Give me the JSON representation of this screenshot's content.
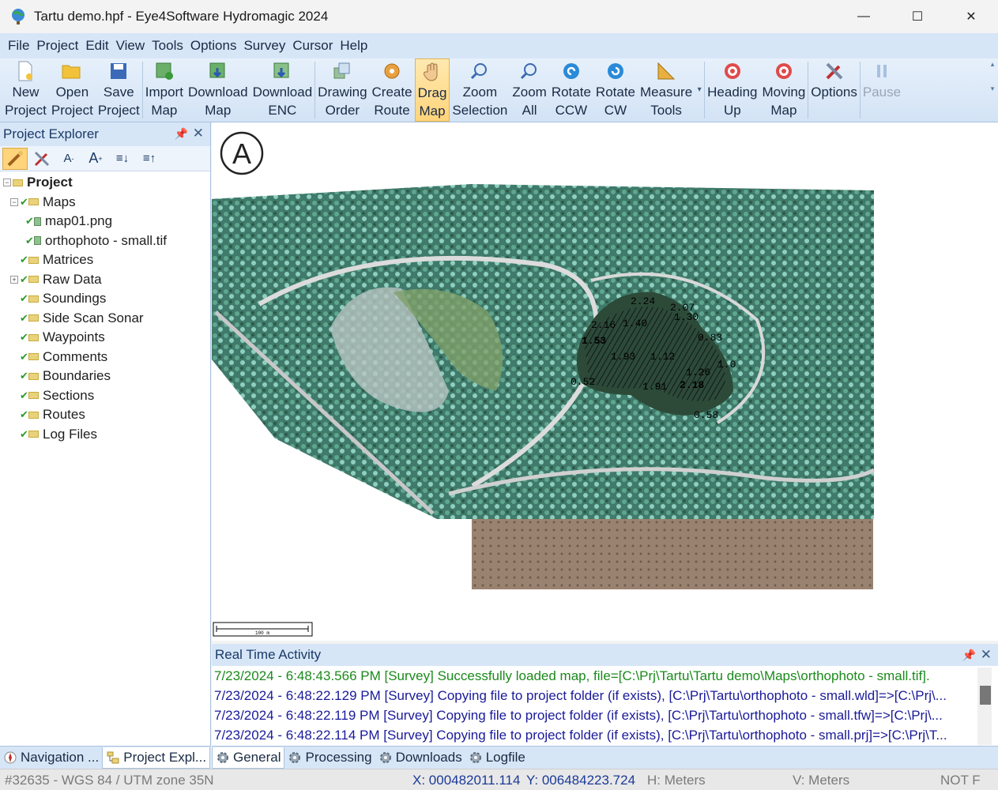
{
  "window": {
    "title": "Tartu demo.hpf - Eye4Software Hydromagic 2024",
    "minimize": "—",
    "maximize": "☐",
    "close": "✕"
  },
  "menu": [
    "File",
    "Project",
    "Edit",
    "View",
    "Tools",
    "Options",
    "Survey",
    "Cursor",
    "Help"
  ],
  "toolbar": {
    "new_project": [
      "New",
      "Project"
    ],
    "open_project": [
      "Open",
      "Project"
    ],
    "save_project": [
      "Save",
      "Project"
    ],
    "import_map": [
      "Import",
      "Map"
    ],
    "download_map": [
      "Download",
      "Map"
    ],
    "download_enc": [
      "Download",
      "ENC"
    ],
    "drawing_order": [
      "Drawing",
      "Order"
    ],
    "create_route": [
      "Create",
      "Route"
    ],
    "drag_map": [
      "Drag",
      "Map"
    ],
    "zoom_selection": [
      "Zoom",
      "Selection"
    ],
    "zoom_all": [
      "Zoom",
      "All"
    ],
    "rotate_ccw": [
      "Rotate",
      "CCW"
    ],
    "rotate_cw": [
      "Rotate",
      "CW"
    ],
    "measure_tools": [
      "Measure",
      "Tools"
    ],
    "heading_up": [
      "Heading",
      "Up"
    ],
    "moving_map": [
      "Moving",
      "Map"
    ],
    "options": [
      "Options"
    ],
    "pause": [
      "Pause"
    ]
  },
  "project_explorer": {
    "title": "Project Explorer",
    "tree": {
      "root": "Project",
      "maps": "Maps",
      "map1": "map01.png",
      "map2": "orthophoto - small.tif",
      "matrices": "Matrices",
      "raw_data": "Raw Data",
      "soundings": "Soundings",
      "side_scan": "Side Scan Sonar",
      "waypoints": "Waypoints",
      "comments": "Comments",
      "boundaries": "Boundaries",
      "sections": "Sections",
      "routes": "Routes",
      "log_files": "Log Files"
    }
  },
  "left_tabs": {
    "navigation": "Navigation ...",
    "project": "Project Expl..."
  },
  "map": {
    "north_label": "A",
    "scale_label": "100 m",
    "soundings": [
      "2.24",
      "2.07",
      "2.16",
      "1.40",
      "1.53",
      "1.30",
      "1.93",
      "1.12",
      "0.52",
      "1.91",
      "2.18",
      "0.58",
      "1.26",
      "0.83",
      "1.0"
    ]
  },
  "realtime": {
    "title": "Real Time Activity",
    "lines": [
      "7/23/2024 - 6:48:43.566 PM [Survey] Successfully loaded map, file=[C:\\Prj\\Tartu\\Tartu demo\\Maps\\orthophoto - small.tif].",
      "7/23/2024 - 6:48:22.129 PM [Survey] Copying file to project folder (if exists), [C:\\Prj\\Tartu\\orthophoto - small.wld]=>[C:\\Prj\\...",
      "7/23/2024 - 6:48:22.119 PM [Survey] Copying file to project folder (if exists), [C:\\Prj\\Tartu\\orthophoto - small.tfw]=>[C:\\Prj\\...",
      "7/23/2024 - 6:48:22.114 PM [Survey] Copying file to project folder (if exists), [C:\\Prj\\Tartu\\orthophoto - small.prj]=>[C:\\Prj\\T..."
    ]
  },
  "bottom_tabs": {
    "general": "General",
    "processing": "Processing",
    "downloads": "Downloads",
    "logfile": "Logfile"
  },
  "status": {
    "crs": "#32635 - WGS 84 / UTM zone 35N",
    "x": "X: 000482011.114",
    "y": "Y: 006484223.724",
    "h": "H: Meters",
    "v": "V: Meters",
    "gps": "NOT F"
  }
}
